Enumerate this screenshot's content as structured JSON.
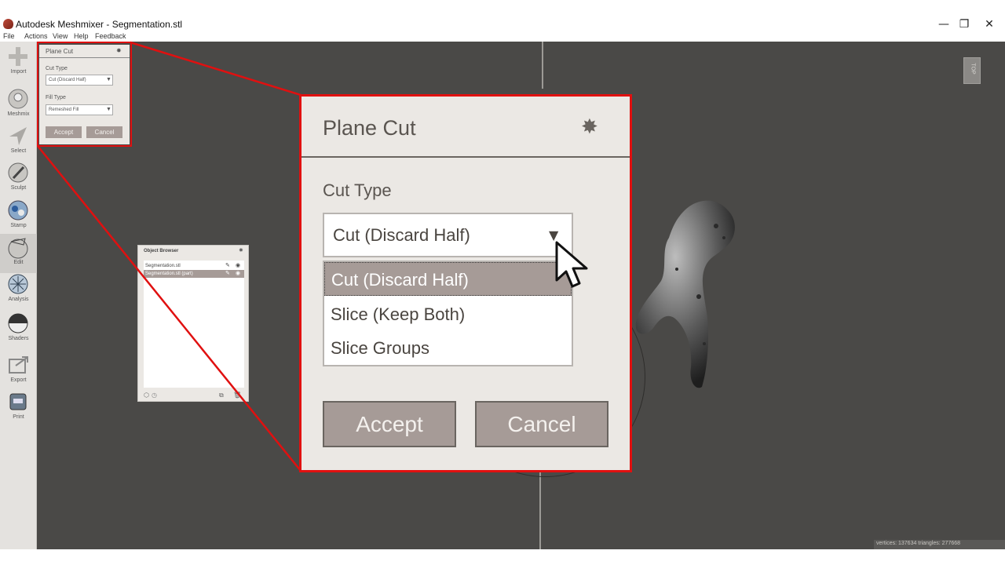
{
  "window": {
    "title": "Autodesk Meshmixer - Segmentation.stl",
    "minimize_glyph": "—",
    "restore_glyph": "❐",
    "close_glyph": "✕"
  },
  "menubar": {
    "items": [
      "File",
      "Actions",
      "View",
      "Help",
      "Feedback"
    ]
  },
  "toolbar": {
    "items": [
      {
        "label": "Import",
        "icon": "plus-icon"
      },
      {
        "label": "Meshmix",
        "icon": "meshmix-icon"
      },
      {
        "label": "Select",
        "icon": "select-arrow-icon"
      },
      {
        "label": "Sculpt",
        "icon": "sculpt-brush-icon"
      },
      {
        "label": "Stamp",
        "icon": "stamp-icon"
      },
      {
        "label": "Edit",
        "icon": "edit-icon"
      },
      {
        "label": "Analysis",
        "icon": "analysis-icon"
      },
      {
        "label": "Shaders",
        "icon": "shaders-icon"
      },
      {
        "label": "Export",
        "icon": "export-icon"
      },
      {
        "label": "Print",
        "icon": "print-icon"
      }
    ],
    "active": "Edit"
  },
  "small_panel": {
    "title": "Plane Cut",
    "cut_type_label": "Cut Type",
    "cut_type_value": "Cut (Discard Half)",
    "fill_type_label": "Fill Type",
    "fill_type_value": "Remeshed Fill",
    "accept_label": "Accept",
    "cancel_label": "Cancel"
  },
  "object_browser": {
    "title": "Object Browser",
    "objects": [
      {
        "name": "Segmentation.stl",
        "selected": false
      },
      {
        "name": "Segmentation.stl (part)",
        "selected": true
      }
    ]
  },
  "zoom_panel": {
    "title": "Plane Cut",
    "cut_type_label": "Cut Type",
    "selected_value": "Cut (Discard Half)",
    "arrow": "▼",
    "options": [
      "Cut (Discard Half)",
      "Slice (Keep Both)",
      "Slice Groups"
    ],
    "selected_index": 0,
    "accept_label": "Accept",
    "cancel_label": "Cancel"
  },
  "viewport": {
    "view_cube_label": "TOP",
    "status": "vertices: 137634 triangles: 277668",
    "background_color": "#4a4947"
  },
  "colors": {
    "highlight": "#e01010",
    "button": "#a69b97",
    "panel": "#ebe8e4"
  }
}
